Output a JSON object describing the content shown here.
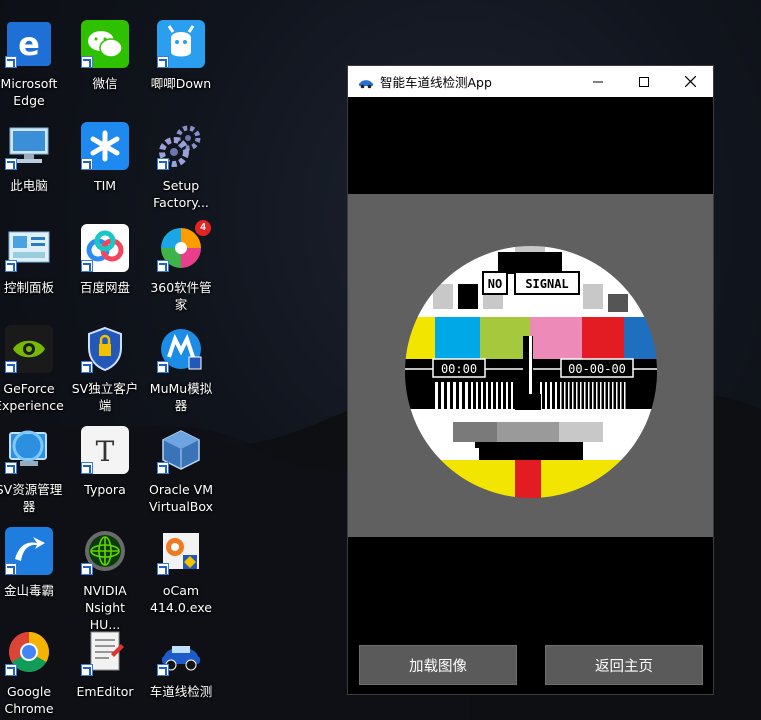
{
  "desktop": {
    "icons": [
      {
        "label": "Microsoft\nEdge",
        "icon": "edge-icon"
      },
      {
        "label": "微信",
        "icon": "wechat-icon"
      },
      {
        "label": "唧唧Down",
        "icon": "jijidown-icon"
      },
      {
        "label": "此电脑",
        "icon": "this-pc-icon"
      },
      {
        "label": "TIM",
        "icon": "tim-icon"
      },
      {
        "label": "Setup\nFactory...",
        "icon": "setup-factory-icon"
      },
      {
        "label": "控制面板",
        "icon": "control-panel-icon"
      },
      {
        "label": "百度网盘",
        "icon": "baidu-netdisk-icon"
      },
      {
        "label": "360软件管家",
        "icon": "360-software-icon",
        "badge": "4"
      },
      {
        "label": "GeForce\nExperience",
        "icon": "geforce-icon"
      },
      {
        "label": "SV独立客户\n端",
        "icon": "sv-client-icon"
      },
      {
        "label": "MuMu模拟\n器",
        "icon": "mumu-icon"
      },
      {
        "label": "SV资源管理\n器",
        "icon": "sv-explorer-icon"
      },
      {
        "label": "Typora",
        "icon": "typora-icon"
      },
      {
        "label": "Oracle VM\nVirtualBox",
        "icon": "virtualbox-icon"
      },
      {
        "label": "金山毒霸",
        "icon": "kingsoft-icon"
      },
      {
        "label": "NVIDIA\nNsight HU...",
        "icon": "nsight-icon"
      },
      {
        "label": "oCam\n414.0.exe",
        "icon": "ocam-icon"
      },
      {
        "label": "Google\nChrome",
        "icon": "chrome-icon"
      },
      {
        "label": "EmEditor",
        "icon": "emeditor-icon"
      },
      {
        "label": "车道线检测",
        "icon": "lane-detect-icon"
      }
    ]
  },
  "window": {
    "title": "智能车道线检测App",
    "test_card": {
      "label_no": "NO",
      "label_signal": "SIGNAL",
      "time_left": "00:00",
      "time_right": "00-00-00"
    },
    "buttons": {
      "load_image": "加载图像",
      "back_home": "返回主页"
    }
  }
}
